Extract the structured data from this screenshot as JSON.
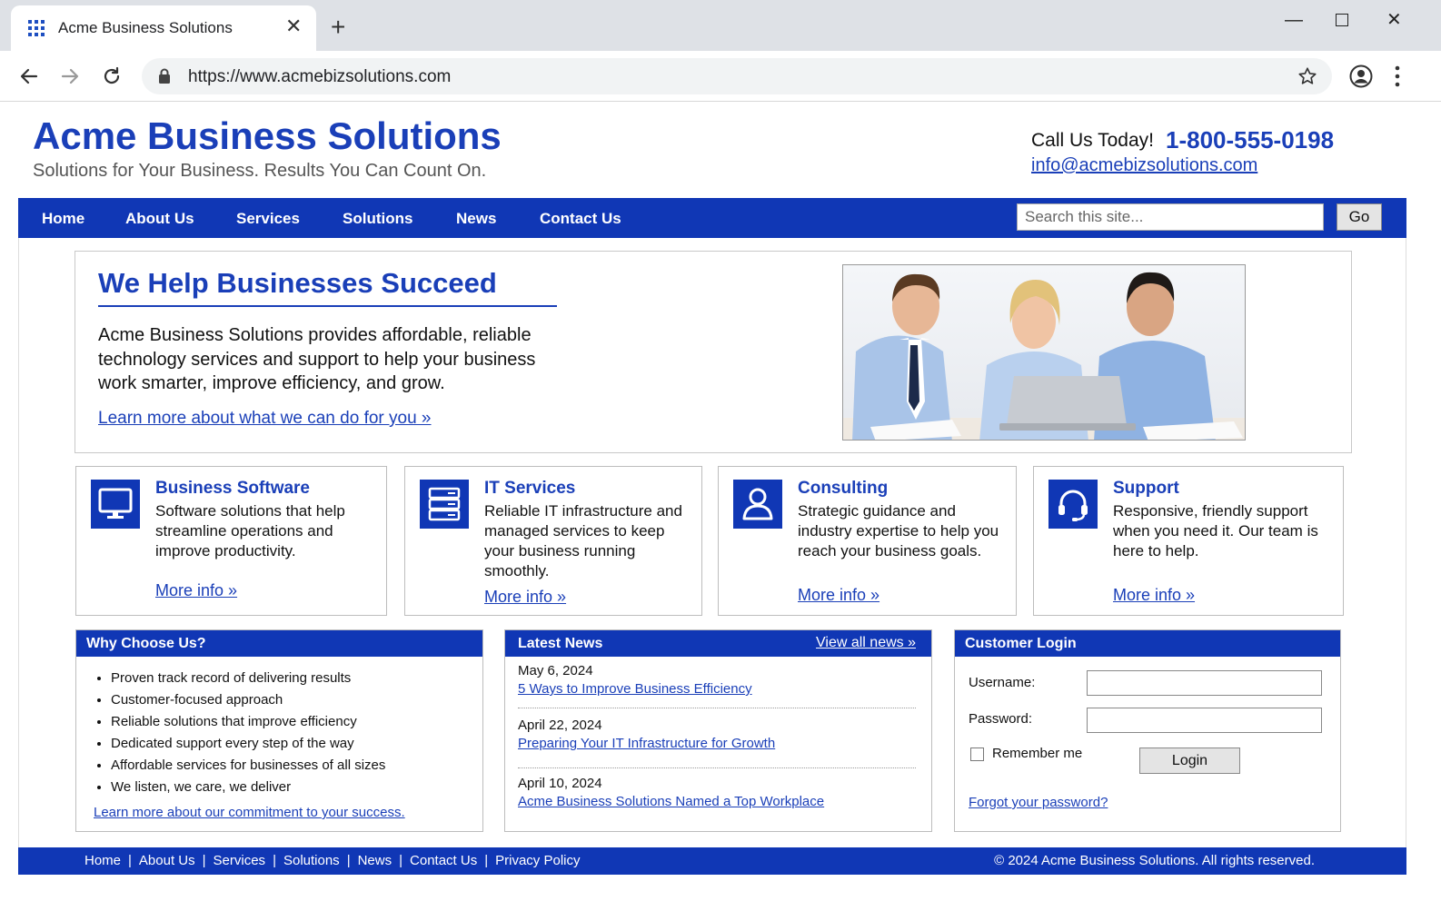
{
  "browser": {
    "tab_title": "Acme Business Solutions",
    "url": "https://www.acmebizsolutions.com"
  },
  "header": {
    "site_title": "Acme Business Solutions",
    "tagline": "Solutions for Your Business. Results You Can Count On.",
    "call_label": "Call Us Today!",
    "phone": "1-800-555-0198",
    "email": "info@acmebizsolutions.com"
  },
  "nav": {
    "items": [
      "Home",
      "About Us",
      "Services",
      "Solutions",
      "News",
      "Contact Us"
    ],
    "search_placeholder": "Search this site...",
    "go_label": "Go"
  },
  "hero": {
    "title": "We Help Businesses Succeed",
    "body": "Acme Business Solutions provides affordable, reliable technology services and support to help your business work smarter, improve efficiency, and grow.",
    "link": "Learn more about what we can do for you »"
  },
  "services": [
    {
      "title": "Business Software",
      "text": "Software solutions that help streamline operations and improve productivity.",
      "link": "More info »",
      "icon": "monitor-icon"
    },
    {
      "title": "IT Services",
      "text": "Reliable IT infrastructure and managed services to keep your business running smoothly.",
      "link": "More info »",
      "icon": "server-icon"
    },
    {
      "title": "Consulting",
      "text": "Strategic guidance and industry expertise to help you reach your business goals.",
      "link": "More info »",
      "icon": "person-icon"
    },
    {
      "title": "Support",
      "text": "Responsive, friendly support when you need it. Our team is here to help.",
      "link": "More info »",
      "icon": "headset-icon"
    }
  ],
  "why": {
    "title": "Why Choose Us?",
    "items": [
      "Proven track record of delivering results",
      "Customer-focused approach",
      "Reliable solutions that improve efficiency",
      "Dedicated support every step of the way",
      "Affordable services for businesses of all sizes",
      "We listen, we care, we deliver"
    ],
    "link": "Learn more about our commitment to your success."
  },
  "news": {
    "title": "Latest News",
    "view_all": "View all news »",
    "items": [
      {
        "date": "May 6, 2024",
        "headline": "5 Ways to Improve Business Efficiency"
      },
      {
        "date": "April 22, 2024",
        "headline": "Preparing Your IT Infrastructure for Growth"
      },
      {
        "date": "April 10, 2024",
        "headline": "Acme Business Solutions Named a Top Workplace"
      }
    ]
  },
  "login": {
    "title": "Customer Login",
    "username_label": "Username:",
    "password_label": "Password:",
    "remember_label": "Remember me",
    "button_label": "Login",
    "forgot_label": "Forgot your password?"
  },
  "footer": {
    "links": [
      "Home",
      "About Us",
      "Services",
      "Solutions",
      "News",
      "Contact Us",
      "Privacy Policy"
    ],
    "separator": "|",
    "copyright": "© 2024 Acme Business Solutions. All rights reserved."
  },
  "colors": {
    "brand_blue": "#1037b5",
    "link_blue": "#1a3fb8"
  }
}
